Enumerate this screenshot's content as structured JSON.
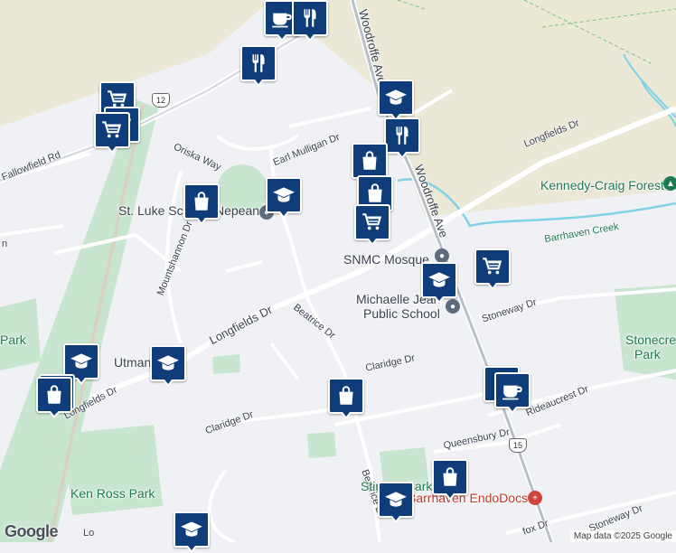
{
  "map": {
    "streets": {
      "woodroffe_north": "Woodroffe Ave",
      "woodroffe_south": "Woodroffe Ave",
      "longfields_ne": "Longfields Dr",
      "longfields_center": "Longfields Dr",
      "longfields_west": "Longfields Dr",
      "earl_mulligan": "Earl Mulligan Dr",
      "oriska": "Oriska Way",
      "mountshannon": "Mountshannon Dr",
      "beatrice_north": "Beatrice Dr",
      "beatrice_south": "Beatrice Dr",
      "claridge_east": "Claridge Dr",
      "claridge_west": "Claridge Dr",
      "stoneway_north": "Stoneway Dr",
      "stoneway_south": "Stoneway Dr",
      "queensbury": "Queensbury Dr",
      "rideaucrest": "Rideaucrest Dr",
      "fallowfield": "Fallowfield Rd",
      "left_edge_a": "n",
      "left_edge_b": "Lo",
      "bottom_fox": "fox Dr"
    },
    "places": {
      "kennedy_craig": "Kennedy-Craig Forest",
      "barrhaven_creek": "Barrhaven Creek",
      "st_luke": "St. Luke School",
      "nepean": "Nepean",
      "snmc": "SNMC Mosque",
      "michaelle_1": "Michaelle Jean",
      "michaelle_2": "Public School",
      "stonecrest_1": "Stonecre",
      "stonecrest_2": "Park",
      "utman": "Utman",
      "ken_ross": "Ken Ross Park",
      "stinson": "Stinson Park",
      "endodocs": "Barrhaven EndoDocs",
      "left_park": "Park"
    },
    "shields": {
      "r12": "12",
      "r15": "15"
    },
    "google_logo": "Google",
    "attribution": "Map data ©2025 Google"
  },
  "markers": [
    {
      "icon": "coffee",
      "name": "cafe"
    },
    {
      "icon": "restaurant",
      "name": "restaurant"
    },
    {
      "icon": "shopping-cart",
      "name": "grocery"
    },
    {
      "icon": "shopping-cart",
      "name": "grocery"
    },
    {
      "icon": "restaurant",
      "name": "restaurant"
    },
    {
      "icon": "school",
      "name": "school"
    },
    {
      "icon": "restaurant",
      "name": "restaurant"
    },
    {
      "icon": "shopping-bag",
      "name": "store"
    },
    {
      "icon": "shopping-bag",
      "name": "store"
    },
    {
      "icon": "school",
      "name": "school"
    },
    {
      "icon": "shopping-bag",
      "name": "store"
    },
    {
      "icon": "shopping-cart",
      "name": "grocery"
    },
    {
      "icon": "shopping-cart",
      "name": "grocery"
    },
    {
      "icon": "school",
      "name": "school"
    },
    {
      "icon": "shopping-cart",
      "name": "grocery"
    },
    {
      "icon": "school",
      "name": "school"
    },
    {
      "icon": "school",
      "name": "school"
    },
    {
      "icon": "shopping-bag",
      "name": "store"
    },
    {
      "icon": "shopping-bag",
      "name": "store"
    },
    {
      "icon": "restaurant",
      "name": "restaurant"
    },
    {
      "icon": "coffee",
      "name": "cafe"
    },
    {
      "icon": "shopping-bag",
      "name": "store"
    },
    {
      "icon": "school",
      "name": "school"
    },
    {
      "icon": "school",
      "name": "school"
    },
    {
      "icon": "shopping-bag",
      "name": "store"
    }
  ],
  "colors": {
    "marker": "#0f3d7a",
    "park": "#c8e6cf",
    "water": "#7fd3e6",
    "road": "#ffffff",
    "highway": "#b9bfc9",
    "farm": "#ebe8d5"
  }
}
